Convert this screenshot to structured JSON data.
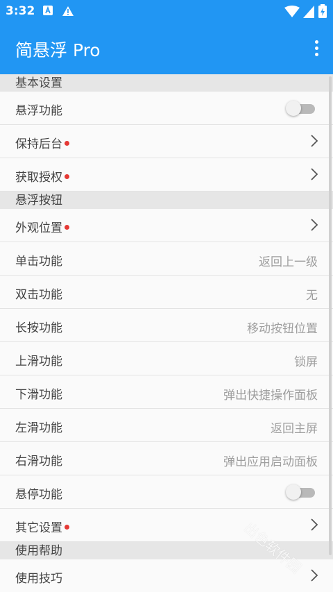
{
  "status_bar": {
    "time": "3:32"
  },
  "app_bar": {
    "title": "简悬浮 Pro"
  },
  "sections": {
    "basic": {
      "header": "基本设置",
      "float_function": "悬浮功能",
      "keep_background": "保持后台",
      "get_permission": "获取授权"
    },
    "button": {
      "header": "悬浮按钮",
      "appearance_position": "外观位置",
      "single_click": {
        "label": "单击功能",
        "value": "返回上一级"
      },
      "double_click": {
        "label": "双击功能",
        "value": "无"
      },
      "long_press": {
        "label": "长按功能",
        "value": "移动按钮位置"
      },
      "swipe_up": {
        "label": "上滑功能",
        "value": "锁屏"
      },
      "swipe_down": {
        "label": "下滑功能",
        "value": "弹出快捷操作面板"
      },
      "swipe_left": {
        "label": "左滑功能",
        "value": "返回主屏"
      },
      "swipe_right": {
        "label": "右滑功能",
        "value": "弹出应用启动面板"
      },
      "hover_function": "悬停功能",
      "other_settings": "其它设置"
    },
    "help": {
      "header": "使用帮助",
      "tips": "使用技巧"
    }
  },
  "toggles": {
    "float_function_on": false,
    "hover_function_on": false
  },
  "watermark": "出色软件园",
  "colors": {
    "primary": "#2196f3",
    "badge": "#e53935"
  }
}
